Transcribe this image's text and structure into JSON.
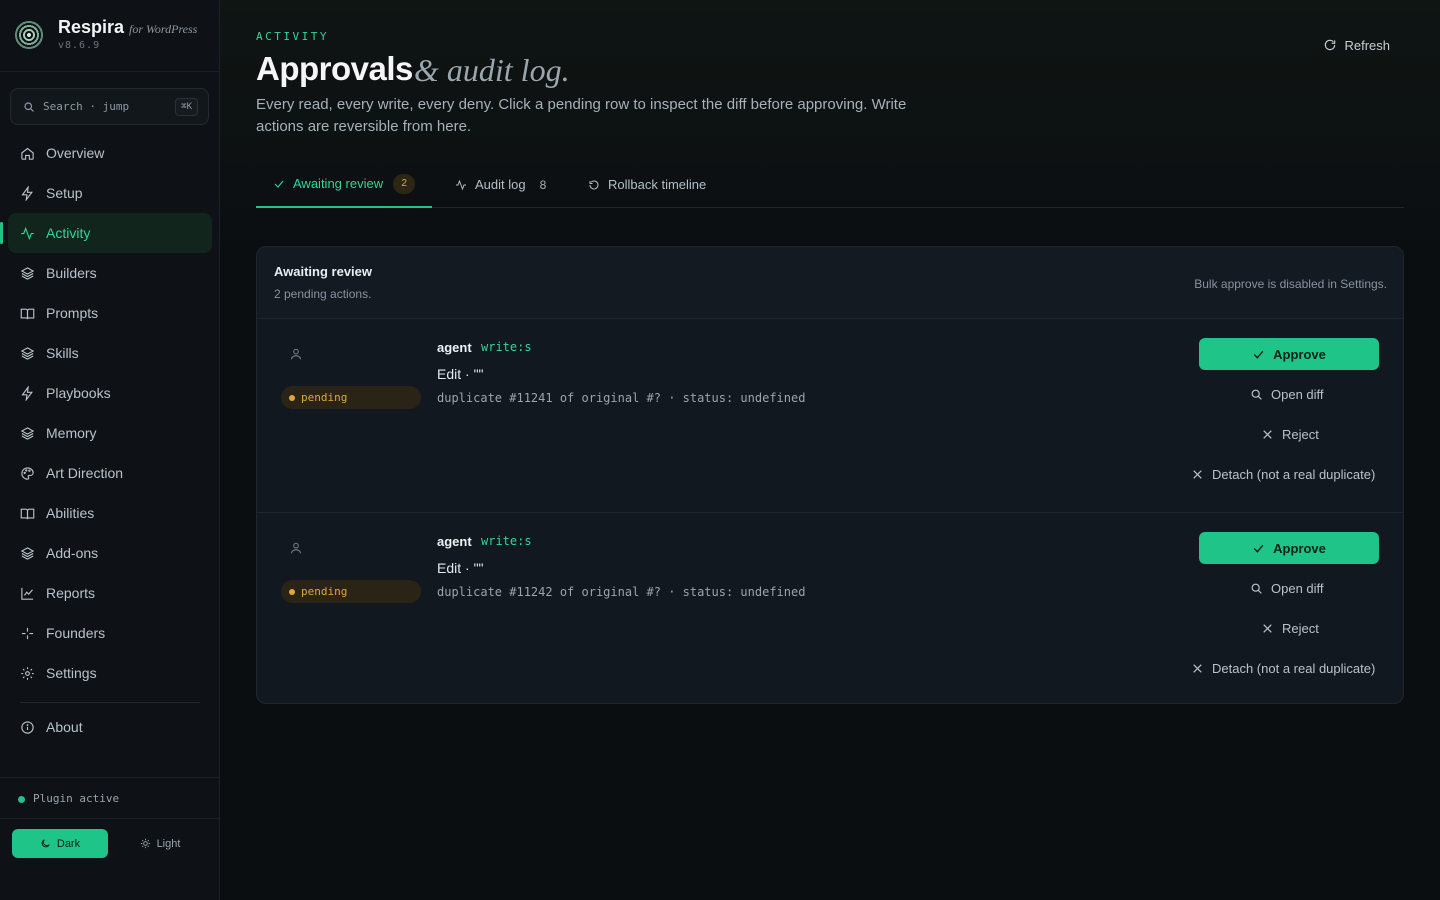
{
  "app": {
    "name": "Respira",
    "subtitle": "for WordPress",
    "version": "v8.6.9"
  },
  "search": {
    "placeholder": "Search · jump",
    "shortcut": "⌘K"
  },
  "sidebar": {
    "items": [
      {
        "label": "Overview",
        "icon": "home-icon"
      },
      {
        "label": "Setup",
        "icon": "bolt-icon"
      },
      {
        "label": "Activity",
        "icon": "activity-icon",
        "active": true
      },
      {
        "label": "Builders",
        "icon": "layers-icon"
      },
      {
        "label": "Prompts",
        "icon": "book-icon"
      },
      {
        "label": "Skills",
        "icon": "layers-icon"
      },
      {
        "label": "Playbooks",
        "icon": "bolt-icon"
      },
      {
        "label": "Memory",
        "icon": "layers-icon"
      },
      {
        "label": "Art Direction",
        "icon": "palette-icon"
      },
      {
        "label": "Abilities",
        "icon": "book-icon"
      },
      {
        "label": "Add-ons",
        "icon": "layers-icon"
      },
      {
        "label": "Reports",
        "icon": "chart-icon"
      },
      {
        "label": "Founders",
        "icon": "sparkle-icon"
      },
      {
        "label": "Settings",
        "icon": "gear-icon"
      }
    ],
    "about": {
      "label": "About",
      "icon": "info-icon"
    },
    "status": "Plugin active",
    "theme": {
      "dark": "Dark",
      "light": "Light"
    }
  },
  "header": {
    "eyebrow": "ACTIVITY",
    "title": "Approvals",
    "title_italic": "& audit log.",
    "description": "Every read, every write, every deny. Click a pending row to inspect the diff before approving. Write actions are reversible from here.",
    "refresh_label": "Refresh"
  },
  "tabs": [
    {
      "label": "Awaiting review",
      "count": "2",
      "active": true
    },
    {
      "label": "Audit log",
      "count": "8"
    },
    {
      "label": "Rollback timeline"
    }
  ],
  "panel": {
    "title": "Awaiting review",
    "subtitle": "2 pending actions.",
    "note": "Bulk approve is disabled in Settings.",
    "rows": [
      {
        "status": "pending",
        "actor": "agent",
        "scope": "write:s",
        "action": "Edit · \"\"",
        "meta": "duplicate #11241 of original #? · status: undefined",
        "approve": "Approve",
        "open_diff": "Open diff",
        "reject": "Reject",
        "detach": "Detach (not a real duplicate)"
      },
      {
        "status": "pending",
        "actor": "agent",
        "scope": "write:s",
        "action": "Edit · \"\"",
        "meta": "duplicate #11242 of original #? · status: undefined",
        "approve": "Approve",
        "open_diff": "Open diff",
        "reject": "Reject",
        "detach": "Detach (not a real duplicate)"
      }
    ]
  },
  "colors": {
    "accent": "#1fc488",
    "pending": "#e2a63b",
    "background": "#0b0e11"
  }
}
